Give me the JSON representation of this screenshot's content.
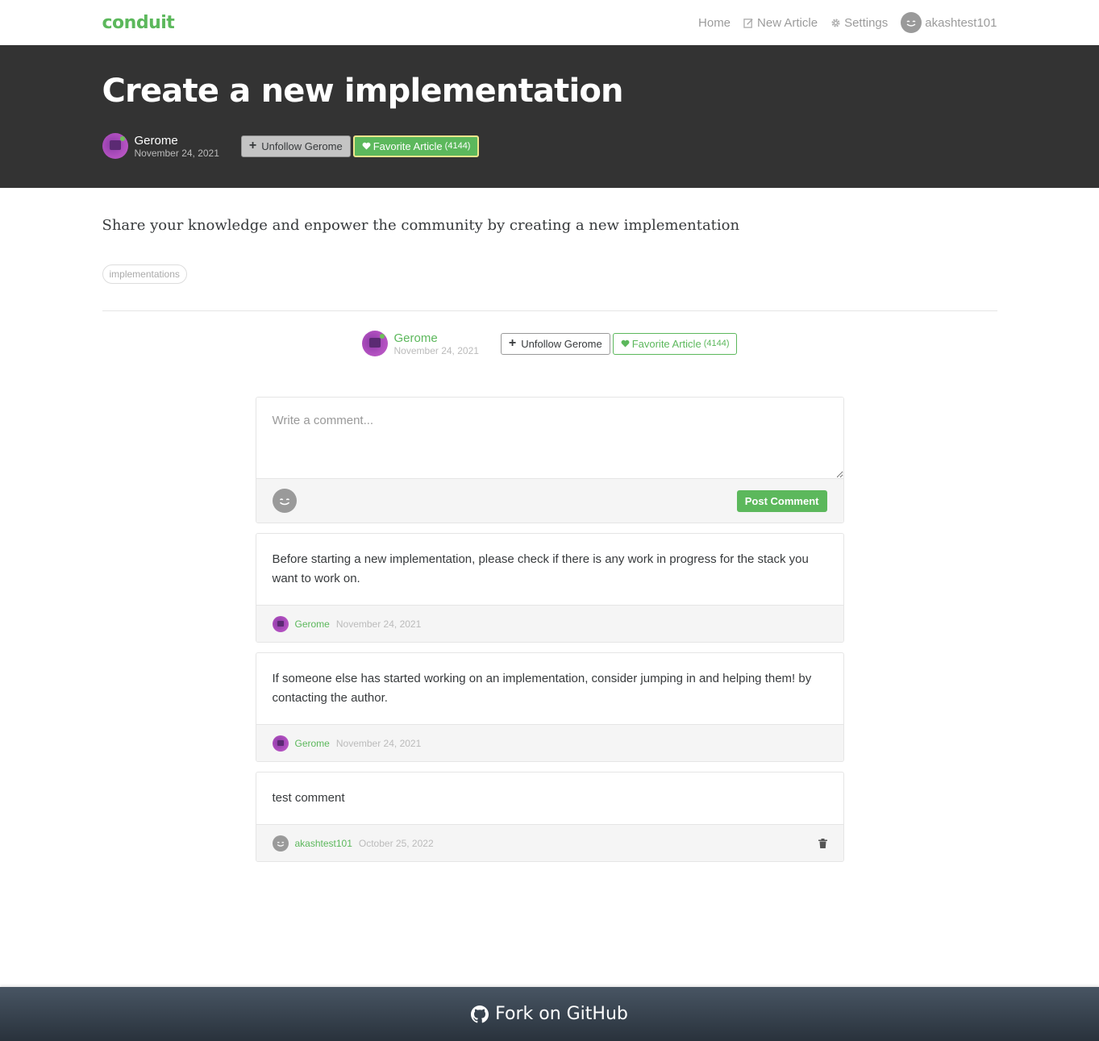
{
  "navbar": {
    "brand": "conduit",
    "links": {
      "home": "Home",
      "new_article": "New Article",
      "settings": "Settings",
      "username": "akashtest101"
    }
  },
  "article": {
    "title": "Create a new implementation",
    "author": "Gerome",
    "date": "November 24, 2021",
    "follow_label": "Unfollow Gerome",
    "favorite_label": "Favorite Article",
    "favorite_count": "(4144)",
    "body": "Share your knowledge and enpower the community by creating a new implementation",
    "tags": [
      "implementations"
    ]
  },
  "comment_form": {
    "placeholder": "Write a comment...",
    "submit_label": "Post Comment"
  },
  "comments": [
    {
      "body": "Before starting a new implementation, please check if there is any work in progress for the stack you want to work on.",
      "author": "Gerome",
      "date": "November 24, 2021"
    },
    {
      "body": "If someone else has started working on an implementation, consider jumping in and helping them! by contacting the author.",
      "author": "Gerome",
      "date": "November 24, 2021"
    },
    {
      "body": "test comment",
      "author": "akashtest101",
      "date": "October 25, 2022"
    }
  ],
  "footer": {
    "label": "Fork on GitHub"
  },
  "colors": {
    "brand": "#5cb85c",
    "banner": "#333333",
    "footer_top": "#485563",
    "footer_bottom": "#29323c"
  },
  "icons": [
    "edit-icon",
    "gear-icon",
    "smiley-avatar-icon",
    "plus-icon",
    "heart-icon",
    "trash-icon",
    "github-icon"
  ]
}
